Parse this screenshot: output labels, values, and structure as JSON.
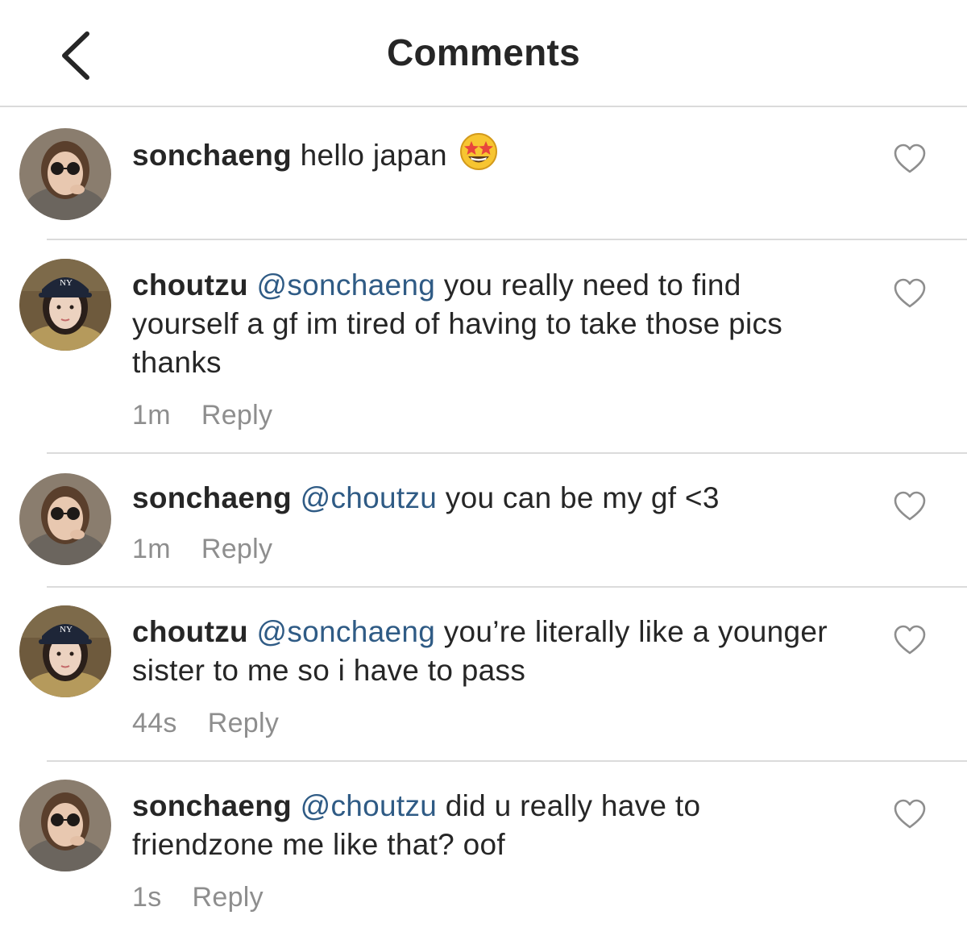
{
  "header": {
    "title": "Comments",
    "back_icon": "chevron-left-icon"
  },
  "comments": [
    {
      "username": "sonchaeng",
      "mention": "",
      "text": " hello japan",
      "emoji": "star-struck-emoji",
      "time": "",
      "reply_label": ""
    },
    {
      "username": "choutzu",
      "mention": "@sonchaeng",
      "text": " you really need to find yourself a gf im tired of having to take those pics thanks",
      "time": "1m",
      "reply_label": "Reply"
    },
    {
      "username": "sonchaeng",
      "mention": "@choutzu",
      "text": " you can be my gf <3",
      "time": "1m",
      "reply_label": "Reply"
    },
    {
      "username": "choutzu",
      "mention": "@sonchaeng",
      "text": " you’re literally like a younger sister to me so i have to pass",
      "time": "44s",
      "reply_label": "Reply"
    },
    {
      "username": "sonchaeng",
      "mention": "@choutzu",
      "text": " did u really have to friendzone me like that? oof",
      "time": "1s",
      "reply_label": "Reply"
    }
  ],
  "colors": {
    "mention": "#2f5b85",
    "meta": "#8e8e8e",
    "divider": "#dbdbdb"
  }
}
